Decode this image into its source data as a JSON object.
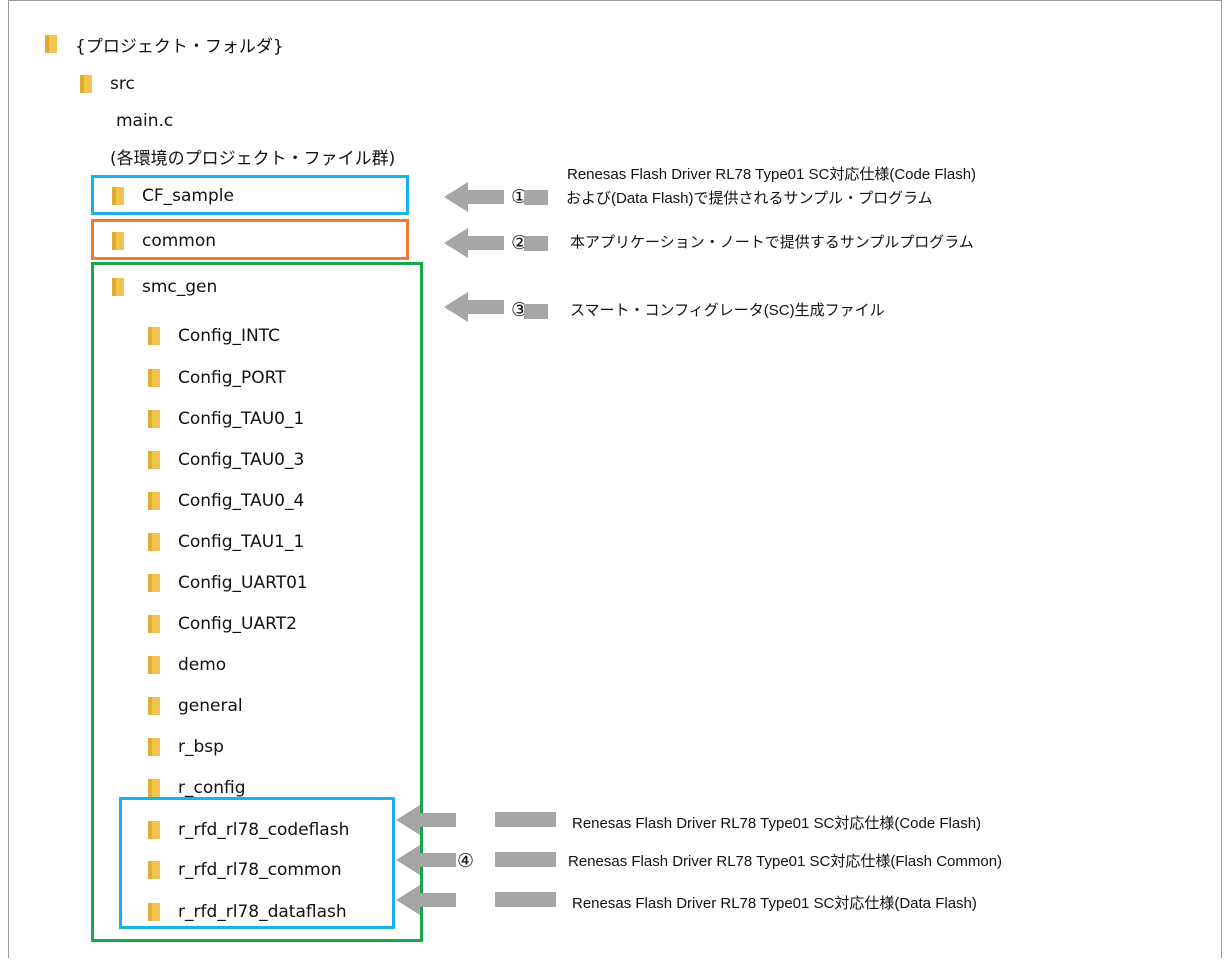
{
  "colors": {
    "folder": "#f1c452",
    "blue": "#1ab0e8",
    "orange": "#ee7d31",
    "green": "#16a94a",
    "arrow": "#a6a6a6"
  },
  "tree": {
    "root": "{プロジェクト・フォルダ}",
    "src": "src",
    "main_c": "main.c",
    "project_files": "(各環境のプロジェクト・ファイル群)",
    "cf_sample": "CF_sample",
    "common": "common",
    "smc_gen": "smc_gen",
    "smc_children": [
      "Config_INTC",
      "Config_PORT",
      "Config_TAU0_1",
      "Config_TAU0_3",
      "Config_TAU0_4",
      "Config_TAU1_1",
      "Config_UART01",
      "Config_UART2",
      "demo",
      "general",
      "r_bsp",
      "r_config"
    ],
    "rfd_children": [
      "r_rfd_rl78_codeflash",
      "r_rfd_rl78_common",
      "r_rfd_rl78_dataflash"
    ]
  },
  "callouts": {
    "n1": "①",
    "n1_line1": "Renesas Flash Driver RL78 Type01 SC対応仕様(Code Flash)",
    "n1_line2": "および(Data Flash)で提供されるサンプル・プログラム",
    "n2": "②",
    "n2_text": "本アプリケーション・ノートで提供するサンプルプログラム",
    "n3": "③",
    "n3_text": "スマート・コンフィグレータ(SC)生成ファイル",
    "n4": "④",
    "n4_codeflash": "Renesas Flash Driver RL78 Type01 SC対応仕様(Code Flash)",
    "n4_common": "Renesas Flash Driver RL78 Type01 SC対応仕様(Flash Common)",
    "n4_dataflash": "Renesas Flash Driver RL78 Type01 SC対応仕様(Data Flash)"
  }
}
